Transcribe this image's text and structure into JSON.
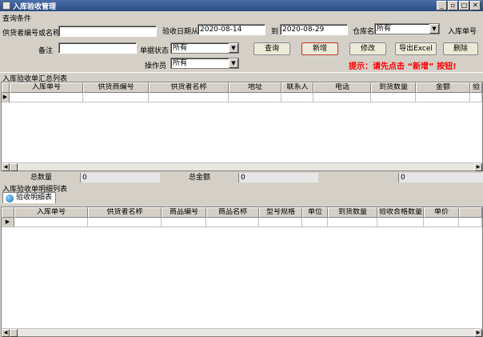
{
  "window": {
    "title": "入库验收管理"
  },
  "query_group": {
    "label": "查询条件"
  },
  "filters": {
    "supplier_label": "供货者编号或名称",
    "supplier_value": "",
    "date_label": "验收日期从",
    "date_from": "2020-08-14",
    "date_to_label": "到",
    "date_to": "2020-08-29",
    "warehouse_label": "仓库名",
    "warehouse_value": "所有",
    "order_no_label": "入库单号",
    "remark_label": "备注",
    "remark_value": "",
    "doc_status_label": "单据状态",
    "doc_status_value": "所有",
    "operator_label": "操作员",
    "operator_value": "所有"
  },
  "buttons": {
    "query": "查询",
    "add": "新增",
    "edit": "修改",
    "export": "导出Excel",
    "delete": "删除"
  },
  "tip": "提示：请先点击 “新增” 按钮!",
  "summary_table": {
    "label": "入库验收单汇总列表",
    "columns": [
      "入库单号",
      "供货商编号",
      "供货者名称",
      "地址",
      "联系人",
      "电话",
      "到货数量",
      "金额",
      "验"
    ],
    "footer": {
      "qty_label": "总数量",
      "qty_value": "0",
      "amount_label": "总金额",
      "amount_value": "0",
      "third_value": "0"
    }
  },
  "detail_table": {
    "label": "入库验收单明细列表",
    "tab": "验收明细表",
    "columns": [
      "入库单号",
      "供货者名称",
      "商品编号",
      "商品名称",
      "型号规格",
      "单位",
      "到货数量",
      "验收合格数量",
      "单价"
    ]
  }
}
